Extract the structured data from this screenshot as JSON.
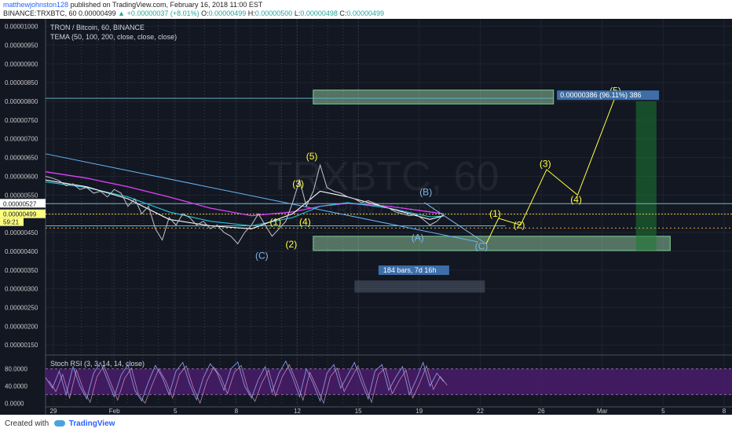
{
  "header": {
    "user": "matthewjohnston128",
    "published": " published on TradingView.com, February 16, 2018 11:00 EST",
    "symbol": "BINANCE:TRXBTC, 60",
    "last": "0.00000499",
    "change_arrow": "▲",
    "change": "+0.00000037 (+8.01%)",
    "o_label": "O:",
    "o": "0.00000499",
    "h_label": "H:",
    "h": "0.00000500",
    "l_label": "L:",
    "l": "0.00000498",
    "c_label": "C:",
    "c": "0.00000499"
  },
  "legend": {
    "title": "TRON / Bitcoin, 60, BINANCE",
    "indicator": "TEMA (50, 100, 200, close, close, close)",
    "rsi": "Stoch RSI (3, 3, 14, 14, close)"
  },
  "watermark": {
    "symbol": "TRXBTC, 60",
    "name": "TRON / Bitcoin"
  },
  "footer": {
    "created": "Created with",
    "brand": "TradingView"
  },
  "colors": {
    "background": "#131722",
    "grid": "#1e2430",
    "price_line": "#c2c5cc",
    "tema_fast": "#fefefe",
    "tema_mid": "#26c6da",
    "tema_slow": "#e040fb",
    "wave_yellow": "#ffff40",
    "wave_blue": "#7fb8e8",
    "box_green": "#a6e5b4",
    "stoch_fill": "#4a1c6a",
    "stoch_line": "#7e8cd8"
  },
  "chart_data": {
    "type": "line",
    "title": "TRON / Bitcoin, 60, BINANCE",
    "xlabel": "",
    "ylabel": "",
    "x_ticks": [
      "29",
      "Feb",
      "5",
      "8",
      "12",
      "15",
      "19",
      "22",
      "26",
      "Mar",
      "5",
      "8"
    ],
    "y_ticks": [
      "0.00001000",
      "0.00000950",
      "0.00000900",
      "0.00000850",
      "0.00000800",
      "0.00000750",
      "0.00000700",
      "0.00000650",
      "0.00000600",
      "0.00000550",
      "0.00000500",
      "0.00000450",
      "0.00000400",
      "0.00000350",
      "0.00000300",
      "0.00000250",
      "0.00000200",
      "0.00000150"
    ],
    "ylim": [
      1.4e-06,
      1.02e-05
    ],
    "xlim": [
      0,
      100
    ],
    "grid": true,
    "price_labels": {
      "level_a": "0.00000527",
      "last": "0.00000499",
      "countdown": "59:21"
    },
    "price_series": [
      [
        0,
        600
      ],
      [
        1,
        595
      ],
      [
        2,
        588
      ],
      [
        3,
        575
      ],
      [
        4,
        580
      ],
      [
        5,
        565
      ],
      [
        6,
        570
      ],
      [
        7,
        555
      ],
      [
        8,
        560
      ],
      [
        9,
        545
      ],
      [
        10,
        565
      ],
      [
        11,
        555
      ],
      [
        12,
        520
      ],
      [
        13,
        540
      ],
      [
        14,
        500
      ],
      [
        15,
        520
      ],
      [
        16,
        460
      ],
      [
        17,
        430
      ],
      [
        18,
        490
      ],
      [
        19,
        470
      ],
      [
        20,
        500
      ],
      [
        21,
        490
      ],
      [
        22,
        470
      ],
      [
        23,
        480
      ],
      [
        24,
        460
      ],
      [
        25,
        470
      ],
      [
        26,
        450
      ],
      [
        27,
        440
      ],
      [
        28,
        420
      ],
      [
        29,
        450
      ],
      [
        30,
        470
      ],
      [
        31,
        500
      ],
      [
        32,
        470
      ],
      [
        33,
        440
      ],
      [
        34,
        460
      ],
      [
        35,
        480
      ],
      [
        36,
        530
      ],
      [
        37,
        590
      ],
      [
        38,
        520
      ],
      [
        39,
        560
      ],
      [
        40,
        630
      ],
      [
        41,
        570
      ],
      [
        42,
        560
      ],
      [
        43,
        555
      ],
      [
        44,
        545
      ],
      [
        45,
        540
      ],
      [
        46,
        530
      ],
      [
        47,
        535
      ],
      [
        48,
        528
      ],
      [
        49,
        520
      ],
      [
        50,
        515
      ],
      [
        51,
        505
      ],
      [
        52,
        500
      ],
      [
        53,
        495
      ],
      [
        54,
        498
      ],
      [
        55,
        485
      ],
      [
        56,
        470
      ],
      [
        57,
        480
      ],
      [
        58,
        499
      ]
    ],
    "tema_fast": [
      [
        0,
        590
      ],
      [
        6,
        572
      ],
      [
        12,
        540
      ],
      [
        18,
        485
      ],
      [
        24,
        468
      ],
      [
        30,
        460
      ],
      [
        36,
        500
      ],
      [
        40,
        560
      ],
      [
        44,
        545
      ],
      [
        50,
        515
      ],
      [
        56,
        485
      ],
      [
        58,
        495
      ]
    ],
    "tema_mid": [
      [
        0,
        585
      ],
      [
        6,
        570
      ],
      [
        12,
        545
      ],
      [
        18,
        505
      ],
      [
        24,
        480
      ],
      [
        30,
        468
      ],
      [
        36,
        490
      ],
      [
        40,
        520
      ],
      [
        44,
        530
      ],
      [
        50,
        515
      ],
      [
        56,
        492
      ],
      [
        58,
        494
      ]
    ],
    "tema_slow": [
      [
        0,
        612
      ],
      [
        6,
        595
      ],
      [
        12,
        572
      ],
      [
        18,
        545
      ],
      [
        24,
        515
      ],
      [
        30,
        495
      ],
      [
        36,
        505
      ],
      [
        40,
        520
      ],
      [
        44,
        528
      ],
      [
        50,
        520
      ],
      [
        56,
        505
      ],
      [
        58,
        500
      ]
    ],
    "target_box": {
      "label": "0.00000386 (96.11%) 386",
      "y1": 830,
      "y2": 793,
      "x1": 39,
      "x2": 74
    },
    "support_box": {
      "y1": 440,
      "y2": 402,
      "x1": 39,
      "x2": 91
    },
    "measure_box": {
      "label": "184 bars, 7d 16h"
    },
    "stoch": {
      "y_ticks": [
        "80.0000",
        "40.0000",
        "0.0000"
      ],
      "ylim": [
        -5,
        105
      ],
      "band": [
        20,
        80
      ],
      "values": [
        [
          0,
          60
        ],
        [
          1,
          35
        ],
        [
          2,
          75
        ],
        [
          3,
          20
        ],
        [
          4,
          85
        ],
        [
          5,
          40
        ],
        [
          6,
          10
        ],
        [
          7,
          70
        ],
        [
          8,
          95
        ],
        [
          9,
          55
        ],
        [
          10,
          15
        ],
        [
          11,
          65
        ],
        [
          12,
          90
        ],
        [
          13,
          30
        ],
        [
          14,
          5
        ],
        [
          15,
          50
        ],
        [
          16,
          88
        ],
        [
          17,
          60
        ],
        [
          18,
          20
        ],
        [
          19,
          75
        ],
        [
          20,
          95
        ],
        [
          21,
          45
        ],
        [
          22,
          8
        ],
        [
          23,
          60
        ],
        [
          24,
          92
        ],
        [
          25,
          70
        ],
        [
          26,
          30
        ],
        [
          27,
          80
        ],
        [
          28,
          96
        ],
        [
          29,
          40
        ],
        [
          30,
          12
        ],
        [
          31,
          55
        ],
        [
          32,
          85
        ],
        [
          33,
          25
        ],
        [
          34,
          70
        ],
        [
          35,
          98
        ],
        [
          36,
          60
        ],
        [
          37,
          15
        ],
        [
          38,
          80
        ],
        [
          39,
          45
        ],
        [
          40,
          5
        ],
        [
          41,
          70
        ],
        [
          42,
          90
        ],
        [
          43,
          35
        ],
        [
          44,
          65
        ],
        [
          45,
          95
        ],
        [
          46,
          50
        ],
        [
          47,
          10
        ],
        [
          48,
          75
        ],
        [
          49,
          90
        ],
        [
          50,
          30
        ],
        [
          51,
          60
        ],
        [
          52,
          85
        ],
        [
          53,
          20
        ],
        [
          54,
          55
        ],
        [
          55,
          95
        ],
        [
          56,
          40
        ],
        [
          57,
          70
        ],
        [
          58,
          50
        ]
      ]
    },
    "wave_labels": [
      {
        "text": "(C)",
        "x": 31.5,
        "y": 380,
        "color": "blue"
      },
      {
        "text": "(1)",
        "x": 33.5,
        "y": 470,
        "color": "yellow"
      },
      {
        "text": "(2)",
        "x": 35.8,
        "y": 410,
        "color": "yellow"
      },
      {
        "text": "(3)",
        "x": 36.8,
        "y": 572,
        "color": "yellow"
      },
      {
        "text": "(4)",
        "x": 37.8,
        "y": 470,
        "color": "yellow"
      },
      {
        "text": "(5)",
        "x": 38.8,
        "y": 645,
        "color": "yellow"
      },
      {
        "text": "(A)",
        "x": 54.2,
        "y": 428,
        "color": "blue"
      },
      {
        "text": "(B)",
        "x": 55.4,
        "y": 550,
        "color": "blue"
      },
      {
        "text": "(C)",
        "x": 63.5,
        "y": 405,
        "color": "blue"
      },
      {
        "text": "(1)",
        "x": 65.5,
        "y": 492,
        "color": "yellow"
      },
      {
        "text": "(2)",
        "x": 69.0,
        "y": 462,
        "color": "yellow"
      },
      {
        "text": "(3)",
        "x": 72.8,
        "y": 625,
        "color": "yellow"
      },
      {
        "text": "(4)",
        "x": 77.3,
        "y": 530,
        "color": "yellow"
      },
      {
        "text": "(5)",
        "x": 83.0,
        "y": 820,
        "color": "yellow"
      }
    ],
    "wave_path_yellow": [
      [
        64.2,
        420
      ],
      [
        66,
        488
      ],
      [
        69.2,
        470
      ],
      [
        73,
        618
      ],
      [
        77.5,
        550
      ],
      [
        83,
        812
      ]
    ],
    "wave_path_blue": [
      [
        55.2,
        530
      ],
      [
        64.2,
        420
      ]
    ]
  }
}
